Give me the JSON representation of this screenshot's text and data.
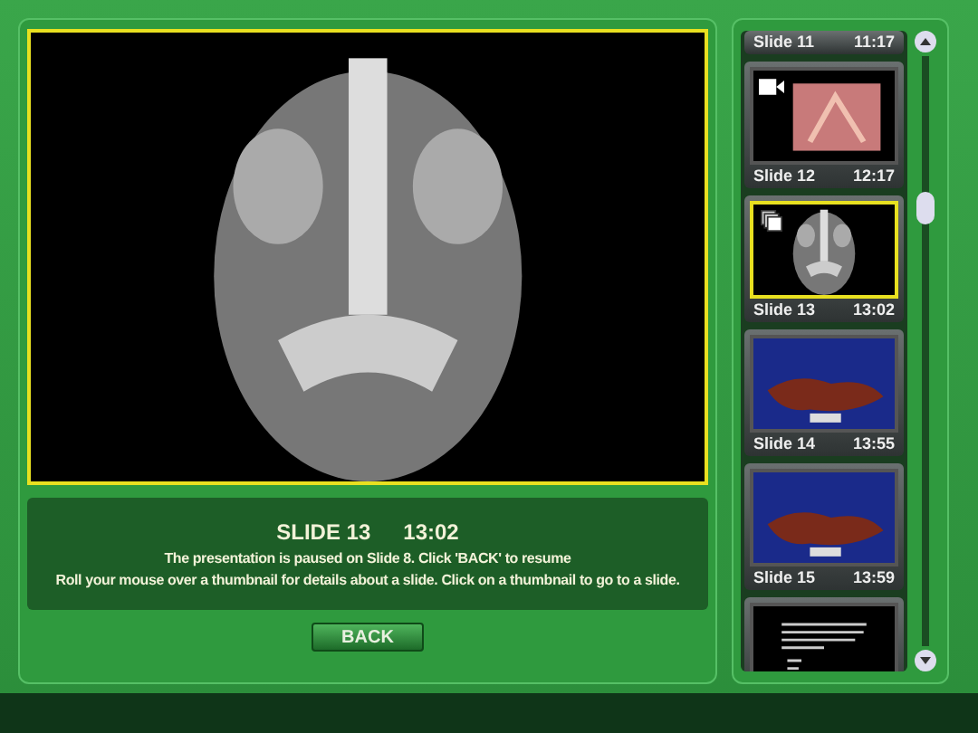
{
  "viewer": {
    "kind": "scan",
    "selected": true
  },
  "info": {
    "title": "SLIDE 13",
    "time": "13:02",
    "messages": [
      "The presentation is paused on Slide 8. Click 'BACK' to resume",
      "Roll your mouse over a thumbnail for details about a slide. Click on a thumbnail to go to a slide."
    ]
  },
  "back_button": {
    "label": "BACK"
  },
  "slides": [
    {
      "label": "Slide 11",
      "time": "11:17",
      "selected": false
    },
    {
      "label": "Slide 12",
      "time": "12:17",
      "thumbnail": {
        "kind": "endoscopy"
      },
      "badge": {
        "kind": "video"
      },
      "selected": false
    },
    {
      "label": "Slide 13",
      "time": "13:02",
      "thumbnail": {
        "kind": "scan"
      },
      "badge": {
        "kind": "stack"
      },
      "selected": true
    },
    {
      "label": "Slide 14",
      "time": "13:55",
      "thumbnail": {
        "kind": "specimen"
      },
      "selected": false
    },
    {
      "label": "Slide 15",
      "time": "13:59",
      "thumbnail": {
        "kind": "specimen"
      },
      "selected": false
    },
    {
      "thumbnail": {
        "kind": "document"
      },
      "selected": false
    }
  ]
}
